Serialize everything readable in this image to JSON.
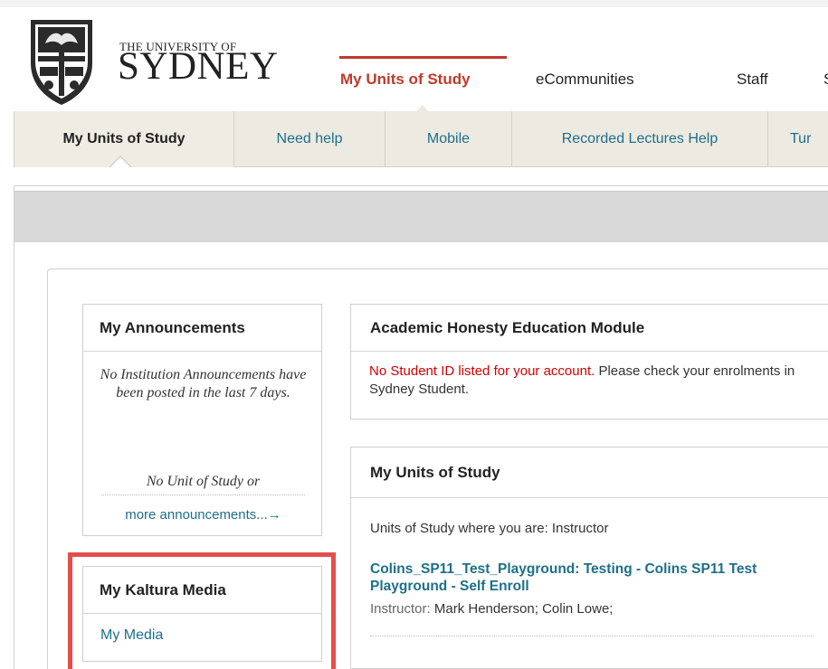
{
  "header": {
    "university_small": "THE UNIVERSITY OF",
    "university_big": "SYDNEY",
    "nav": [
      {
        "label": "My Units of Study",
        "active": true
      },
      {
        "label": "eCommunities",
        "active": false
      },
      {
        "label": "Staff",
        "active": false
      },
      {
        "label": "S",
        "active": false
      }
    ]
  },
  "subnav": {
    "tabs": [
      {
        "label": "My Units of Study",
        "active": true
      },
      {
        "label": "Need help",
        "active": false
      },
      {
        "label": "Mobile",
        "active": false
      },
      {
        "label": "Recorded Lectures Help",
        "active": false
      },
      {
        "label": "Tur",
        "active": false
      }
    ]
  },
  "announcements": {
    "title": "My Announcements",
    "institution_text": "No Institution Announcements have been posted in the last 7 days.",
    "unit_text": "No Unit of Study or",
    "more_link": "more announcements...→"
  },
  "kaltura": {
    "title": "My Kaltura Media",
    "link": "My Media"
  },
  "academic_honesty": {
    "title": "Academic Honesty Education Module",
    "warning": "No Student ID listed for your account.",
    "message": " Please check your enrolments in Sydney Student."
  },
  "units": {
    "title": "My Units of Study",
    "where_text": "Units of Study where you are: Instructor",
    "course_link": "Colins_SP11_Test_Playground: Testing - Colins SP11 Test Playground - Self Enroll",
    "instructor_label": "Instructor:",
    "instructor_names": " Mark Henderson;  Colin Lowe;"
  },
  "colors": {
    "accent_red": "#c0392b",
    "link_teal": "#1d6f8a",
    "highlight": "#e2504c",
    "subnav_bg": "#edeae2"
  }
}
